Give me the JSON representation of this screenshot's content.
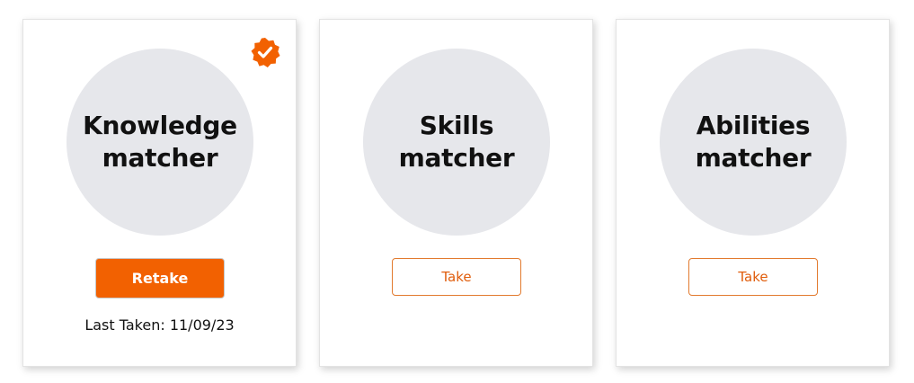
{
  "colors": {
    "accent": "#f26101",
    "circle_bg": "#e6e7eb",
    "outline": "#e27a2e"
  },
  "cards": [
    {
      "title": "Knowledge\nmatcher",
      "completed": true,
      "badge_icon": "check-badge-icon",
      "button_label": "Retake",
      "last_taken": "Last Taken: 11/09/23"
    },
    {
      "title": "Skills\nmatcher",
      "completed": false,
      "button_label": "Take"
    },
    {
      "title": "Abilities\nmatcher",
      "completed": false,
      "button_label": "Take"
    }
  ]
}
